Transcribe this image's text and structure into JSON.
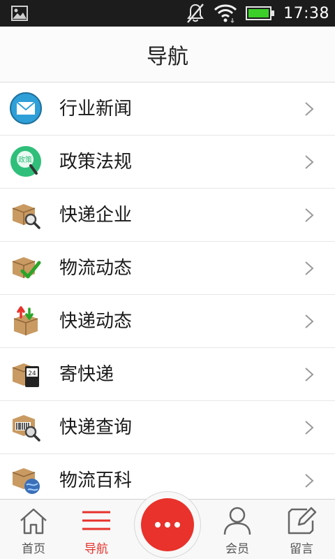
{
  "status_bar": {
    "time": "17:38",
    "icons": [
      "image-notification-icon",
      "notifications-muted-icon",
      "wifi-icon",
      "battery-icon"
    ],
    "battery_color": "#3ccf2a"
  },
  "header": {
    "title": "导航"
  },
  "nav_items": [
    {
      "label": "行业新闻",
      "icon": "mail-icon"
    },
    {
      "label": "政策法规",
      "icon": "policy-icon"
    },
    {
      "label": "快递企业",
      "icon": "package-search-icon"
    },
    {
      "label": "物流动态",
      "icon": "package-check-icon"
    },
    {
      "label": "快递动态",
      "icon": "package-arrows-icon"
    },
    {
      "label": "寄快递",
      "icon": "package-24h-icon"
    },
    {
      "label": "快递查询",
      "icon": "barcode-search-icon"
    },
    {
      "label": "物流百科",
      "icon": "package-globe-icon"
    }
  ],
  "tabbar": {
    "home_label": "首页",
    "nav_label": "导航",
    "member_label": "会员",
    "message_label": "留言",
    "active_color": "#e8322b",
    "center_button_icon": "more-dots-icon"
  }
}
